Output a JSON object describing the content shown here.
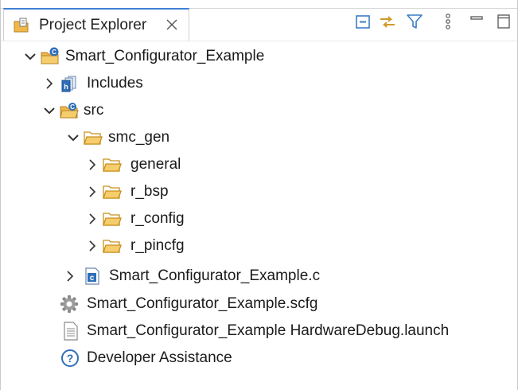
{
  "view": {
    "tab_title": "Project Explorer",
    "tab_icon": "project-explorer-icon",
    "close_icon": "close-icon",
    "toolbar": [
      {
        "name": "collapse-all-icon"
      },
      {
        "name": "link-with-editor-icon"
      },
      {
        "name": "filter-icon"
      },
      {
        "name": "view-menu-icon"
      },
      {
        "name": "minimize-icon"
      },
      {
        "name": "maximize-icon"
      }
    ]
  },
  "tree": {
    "items": [
      {
        "label": "Smart_Configurator_Example",
        "icon": "c-project-folder-icon",
        "expanded": true
      },
      {
        "label": "Includes",
        "icon": "includes-icon",
        "expanded": false
      },
      {
        "label": "src",
        "icon": "source-folder-icon",
        "expanded": true
      },
      {
        "label": "smc_gen",
        "icon": "folder-icon",
        "expanded": true
      },
      {
        "label": "general",
        "icon": "folder-icon",
        "expanded": false
      },
      {
        "label": "r_bsp",
        "icon": "folder-icon",
        "expanded": false
      },
      {
        "label": "r_config",
        "icon": "folder-icon",
        "expanded": false
      },
      {
        "label": "r_pincfg",
        "icon": "folder-icon",
        "expanded": false
      },
      {
        "label": "Smart_Configurator_Example.c",
        "icon": "c-file-icon",
        "expanded": false
      },
      {
        "label": "Smart_Configurator_Example.scfg",
        "icon": "gear-icon"
      },
      {
        "label": "Smart_Configurator_Example HardwareDebug.launch",
        "icon": "launch-file-icon"
      },
      {
        "label": "Developer Assistance",
        "icon": "help-icon"
      }
    ]
  },
  "colors": {
    "tab_accent": "#3f7fd4",
    "folder": "#f0b849",
    "toolbar_icon": "#3b7dc4"
  }
}
